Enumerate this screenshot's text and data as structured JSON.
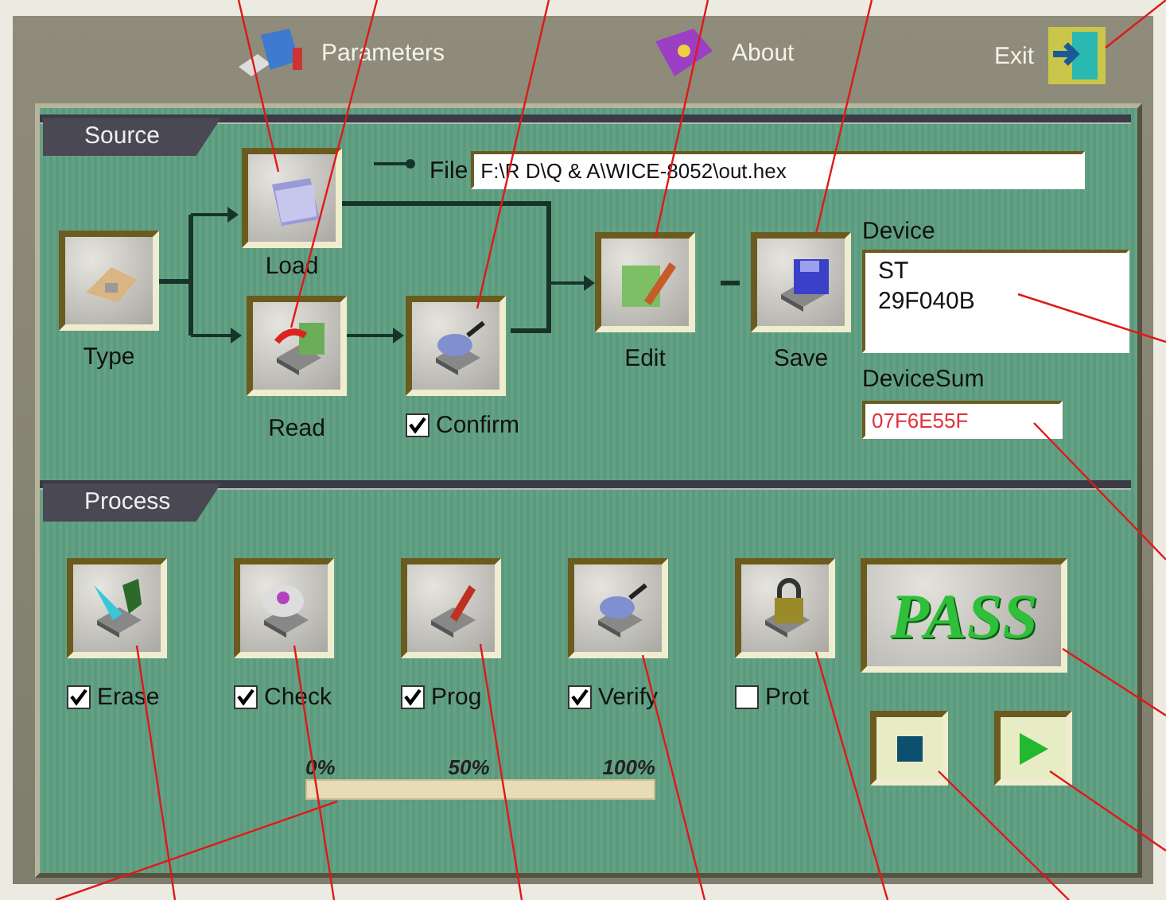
{
  "menu": [
    {
      "label": "Parameters",
      "kind": "parameters"
    },
    {
      "label": "About",
      "kind": "about"
    },
    {
      "label": "Exit",
      "kind": "exit"
    }
  ],
  "source": {
    "title": "Source",
    "file_label": "File",
    "file_value": "F:\\R D\\Q & A\\WICE-8052\\out.hex",
    "steps": [
      {
        "label": "Type",
        "kind": "type"
      },
      {
        "label": "Load",
        "kind": "load"
      },
      {
        "label": "Read",
        "kind": "read"
      },
      {
        "label": "Confirm",
        "kind": "confirm",
        "checked": true
      },
      {
        "label": "Edit",
        "kind": "edit"
      },
      {
        "label": "Save",
        "kind": "save"
      }
    ],
    "device": {
      "label": "Device",
      "lines": [
        "ST",
        "29F040B"
      ]
    },
    "device_sum": {
      "label": "DeviceSum",
      "value": "07F6E55F"
    }
  },
  "process": {
    "title": "Process",
    "steps": [
      {
        "label": "Erase",
        "kind": "erase",
        "checked": true
      },
      {
        "label": "Check",
        "kind": "check",
        "checked": true
      },
      {
        "label": "Prog",
        "kind": "prog",
        "checked": true
      },
      {
        "label": "Verify",
        "kind": "verify",
        "checked": true
      },
      {
        "label": "Prot",
        "kind": "protect",
        "checked": false
      }
    ],
    "result": "PASS",
    "progress": {
      "level": 0,
      "ticks": [
        "0%",
        "50%",
        "100%"
      ]
    }
  }
}
